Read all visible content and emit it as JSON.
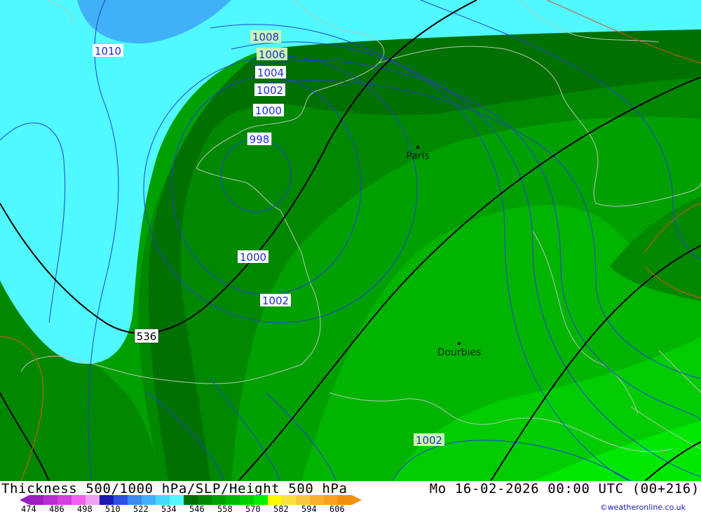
{
  "map": {
    "isobar_labels": [
      {
        "text": "1010",
        "style": "white"
      },
      {
        "text": "1008",
        "style": "green"
      },
      {
        "text": "1006",
        "style": "green"
      },
      {
        "text": "1004",
        "style": "white"
      },
      {
        "text": "1002",
        "style": "white"
      },
      {
        "text": "1000",
        "style": "white"
      },
      {
        "text": "998",
        "style": "white"
      },
      {
        "text": "1000",
        "style": "white"
      },
      {
        "text": "1002",
        "style": "white"
      },
      {
        "text": "1002",
        "style": "green"
      }
    ],
    "height_label": "536",
    "cities": [
      {
        "name": "Paris"
      },
      {
        "name": "Dourbies"
      }
    ]
  },
  "footer": {
    "title": "Thickness 500/1000 hPa/SLP/Height 500 hPa",
    "datetime": "Mo 16-02-2026 00:00 UTC (00+216)",
    "credit": "©weatheronline.co.uk",
    "legend": {
      "ticks": [
        "474",
        "486",
        "498",
        "510",
        "522",
        "534",
        "546",
        "558",
        "570",
        "582",
        "594",
        "606"
      ],
      "colors": [
        "#9b1fbf",
        "#b82fd0",
        "#d43fe0",
        "#f060f0",
        "#f0a0f0",
        "#1a1ab0",
        "#2a50e0",
        "#3a8af0",
        "#40b0f8",
        "#48d8ff",
        "#50f8ff",
        "#007000",
        "#008800",
        "#00a000",
        "#00b800",
        "#00d000",
        "#00f000",
        "#f8f800",
        "#f8e040",
        "#f8c840",
        "#f8b030",
        "#f8a020",
        "#f09010"
      ]
    }
  }
}
